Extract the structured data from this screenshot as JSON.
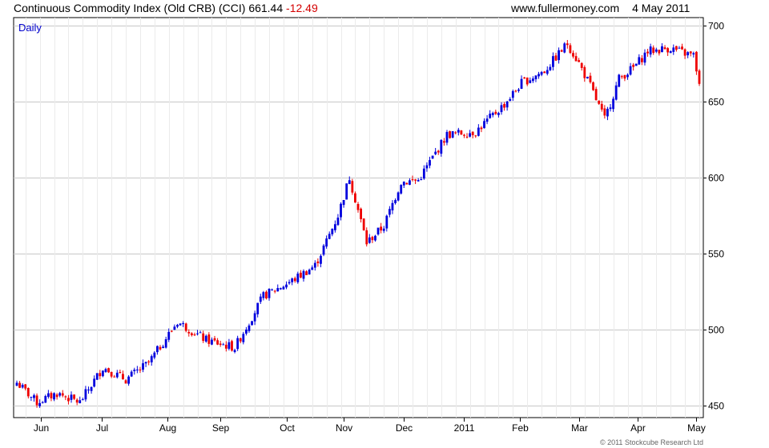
{
  "header": {
    "title": "Continuous Commodity Index (Old CRB) (CCI)",
    "last": "661.44",
    "change": "-12.49",
    "site": "www.fullermoney.com",
    "date": "4 May 2011"
  },
  "footer": {
    "copyright": "© 2011 Stockcube Research Ltd"
  },
  "colors": {
    "up": "#0000dd",
    "down": "#ee0000",
    "grid": "#d9d9d9",
    "frame": "#000000"
  },
  "chart_data": {
    "type": "bar",
    "title": "Continuous Commodity Index (Old CRB) (CCI)",
    "period_label": "Daily",
    "xlabel": "",
    "ylabel": "",
    "ylim": [
      442,
      705
    ],
    "y_ticks": [
      450,
      500,
      550,
      600,
      650,
      700
    ],
    "y_axis_side": "right",
    "grid": true,
    "x_ticks": [
      "Jun",
      "Jul",
      "Aug",
      "Sep",
      "Oct",
      "Nov",
      "Dec",
      "2011",
      "Feb",
      "Mar",
      "Apr",
      "May"
    ],
    "x_tick_positions": [
      8.5,
      29.5,
      52.5,
      71,
      94,
      114,
      135,
      156,
      175.5,
      196,
      216.5,
      237
    ],
    "num_sessions": 239,
    "series": [
      {
        "x": [
          0,
          7,
          14,
          22,
          30,
          38,
          46,
          56,
          66,
          76,
          86,
          96,
          104,
          108,
          112,
          116,
          122,
          128,
          134,
          140,
          150,
          160,
          170,
          176,
          184,
          192,
          196,
          200,
          205,
          210,
          215,
          220,
          228,
          232,
          236,
          238
        ],
        "y": [
          465,
          452,
          458,
          452,
          475,
          467,
          478,
          505,
          493,
          488,
          522,
          532,
          542,
          558,
          575,
          600,
          557,
          568,
          597,
          598,
          628,
          630,
          648,
          662,
          670,
          688,
          675,
          660,
          638,
          665,
          672,
          683,
          685,
          682,
          680,
          662
        ]
      }
    ]
  }
}
